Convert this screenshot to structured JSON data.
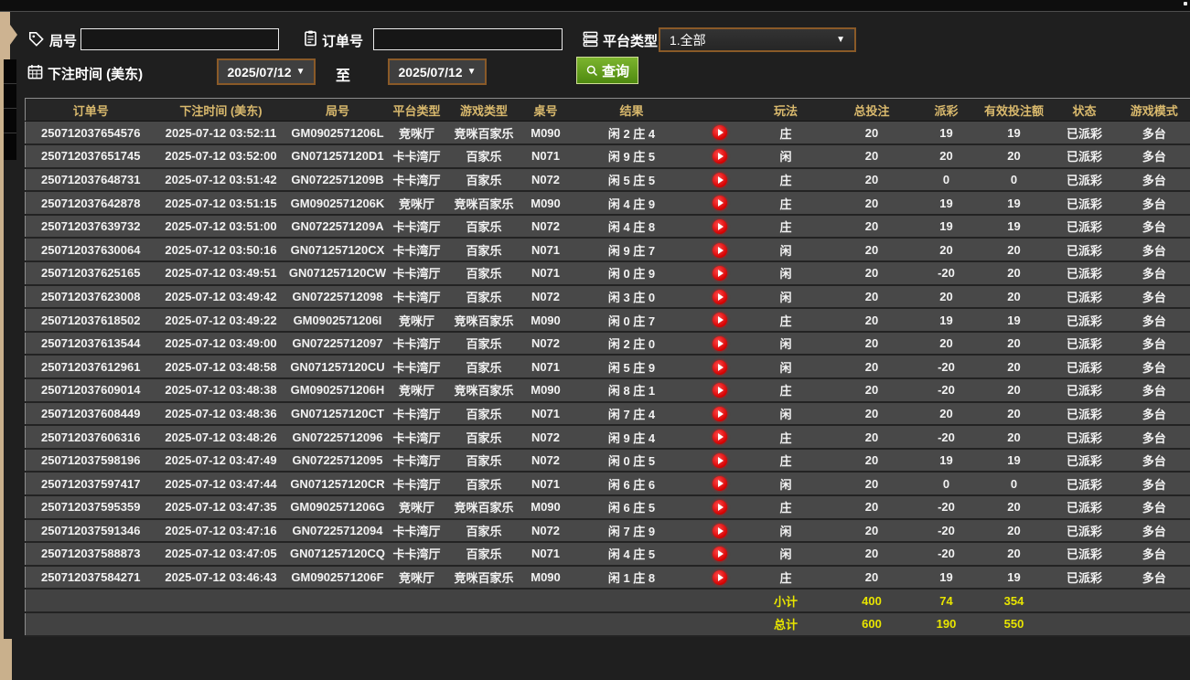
{
  "form": {
    "round_label": "局号",
    "round_value": "",
    "order_label": "订单号",
    "order_value": "",
    "platform_label": "平台类型",
    "platform_value": "1.全部",
    "time_label": "下注时间 (美东)",
    "date_from": "2025/07/12",
    "to_label": "至",
    "date_to": "2025/07/12",
    "query_label": "查询"
  },
  "colors": {
    "header_gold": "#d9b96d",
    "payout_red": "#c40000",
    "payout_green": "#53c500",
    "status_green": "#00c400",
    "totals_yellow": "#e8e500",
    "button_green": "#6aa51e",
    "picker_border_orange": "#8a5a28",
    "side_tan": "#c9b08c"
  },
  "table": {
    "columns": [
      "订单号",
      "下注时间 (美东)",
      "局号",
      "平台类型",
      "游戏类型",
      "桌号",
      "结果",
      "",
      "玩法",
      "总投注",
      "派彩",
      "有效投注额",
      "状态",
      "游戏模式"
    ],
    "rows": [
      {
        "order_no": "250712037654576",
        "bet_time": "2025-07-12 03:52:11",
        "round_no": "GM0902571206L",
        "platform": "竞咪厅",
        "game_type": "竞咪百家乐",
        "table_no": "M090",
        "result": "闲 2 庄 4",
        "play": "庄",
        "total_bet": "20",
        "payout": "19",
        "payout_color": "red",
        "valid_bet": "19",
        "status": "已派彩",
        "mode": "多台"
      },
      {
        "order_no": "250712037651745",
        "bet_time": "2025-07-12 03:52:00",
        "round_no": "GN071257120D1",
        "platform": "卡卡湾厅",
        "game_type": "百家乐",
        "table_no": "N071",
        "result": "闲 9 庄 5",
        "play": "闲",
        "total_bet": "20",
        "payout": "20",
        "payout_color": "red",
        "valid_bet": "20",
        "status": "已派彩",
        "mode": "多台"
      },
      {
        "order_no": "250712037648731",
        "bet_time": "2025-07-12 03:51:42",
        "round_no": "GN0722571209B",
        "platform": "卡卡湾厅",
        "game_type": "百家乐",
        "table_no": "N072",
        "result": "闲 5 庄 5",
        "play": "庄",
        "total_bet": "20",
        "payout": "0",
        "payout_color": "neutral",
        "valid_bet": "0",
        "status": "已派彩",
        "mode": "多台"
      },
      {
        "order_no": "250712037642878",
        "bet_time": "2025-07-12 03:51:15",
        "round_no": "GM0902571206K",
        "platform": "竞咪厅",
        "game_type": "竞咪百家乐",
        "table_no": "M090",
        "result": "闲 4 庄 9",
        "play": "庄",
        "total_bet": "20",
        "payout": "19",
        "payout_color": "red",
        "valid_bet": "19",
        "status": "已派彩",
        "mode": "多台"
      },
      {
        "order_no": "250712037639732",
        "bet_time": "2025-07-12 03:51:00",
        "round_no": "GN0722571209A",
        "platform": "卡卡湾厅",
        "game_type": "百家乐",
        "table_no": "N072",
        "result": "闲 4 庄 8",
        "play": "庄",
        "total_bet": "20",
        "payout": "19",
        "payout_color": "red",
        "valid_bet": "19",
        "status": "已派彩",
        "mode": "多台"
      },
      {
        "order_no": "250712037630064",
        "bet_time": "2025-07-12 03:50:16",
        "round_no": "GN071257120CX",
        "platform": "卡卡湾厅",
        "game_type": "百家乐",
        "table_no": "N071",
        "result": "闲 9 庄 7",
        "play": "闲",
        "total_bet": "20",
        "payout": "20",
        "payout_color": "red",
        "valid_bet": "20",
        "status": "已派彩",
        "mode": "多台"
      },
      {
        "order_no": "250712037625165",
        "bet_time": "2025-07-12 03:49:51",
        "round_no": "GN071257120CW",
        "platform": "卡卡湾厅",
        "game_type": "百家乐",
        "table_no": "N071",
        "result": "闲 0 庄 9",
        "play": "闲",
        "total_bet": "20",
        "payout": "-20",
        "payout_color": "green",
        "valid_bet": "20",
        "status": "已派彩",
        "mode": "多台"
      },
      {
        "order_no": "250712037623008",
        "bet_time": "2025-07-12 03:49:42",
        "round_no": "GN07225712098",
        "platform": "卡卡湾厅",
        "game_type": "百家乐",
        "table_no": "N072",
        "result": "闲 3 庄 0",
        "play": "闲",
        "total_bet": "20",
        "payout": "20",
        "payout_color": "red",
        "valid_bet": "20",
        "status": "已派彩",
        "mode": "多台"
      },
      {
        "order_no": "250712037618502",
        "bet_time": "2025-07-12 03:49:22",
        "round_no": "GM0902571206I",
        "platform": "竞咪厅",
        "game_type": "竞咪百家乐",
        "table_no": "M090",
        "result": "闲 0 庄 7",
        "play": "庄",
        "total_bet": "20",
        "payout": "19",
        "payout_color": "red",
        "valid_bet": "19",
        "status": "已派彩",
        "mode": "多台"
      },
      {
        "order_no": "250712037613544",
        "bet_time": "2025-07-12 03:49:00",
        "round_no": "GN07225712097",
        "platform": "卡卡湾厅",
        "game_type": "百家乐",
        "table_no": "N072",
        "result": "闲 2 庄 0",
        "play": "闲",
        "total_bet": "20",
        "payout": "20",
        "payout_color": "red",
        "valid_bet": "20",
        "status": "已派彩",
        "mode": "多台"
      },
      {
        "order_no": "250712037612961",
        "bet_time": "2025-07-12 03:48:58",
        "round_no": "GN071257120CU",
        "platform": "卡卡湾厅",
        "game_type": "百家乐",
        "table_no": "N071",
        "result": "闲 5 庄 9",
        "play": "闲",
        "total_bet": "20",
        "payout": "-20",
        "payout_color": "green",
        "valid_bet": "20",
        "status": "已派彩",
        "mode": "多台"
      },
      {
        "order_no": "250712037609014",
        "bet_time": "2025-07-12 03:48:38",
        "round_no": "GM0902571206H",
        "platform": "竞咪厅",
        "game_type": "竞咪百家乐",
        "table_no": "M090",
        "result": "闲 8 庄 1",
        "play": "庄",
        "total_bet": "20",
        "payout": "-20",
        "payout_color": "green",
        "valid_bet": "20",
        "status": "已派彩",
        "mode": "多台"
      },
      {
        "order_no": "250712037608449",
        "bet_time": "2025-07-12 03:48:36",
        "round_no": "GN071257120CT",
        "platform": "卡卡湾厅",
        "game_type": "百家乐",
        "table_no": "N071",
        "result": "闲 7 庄 4",
        "play": "闲",
        "total_bet": "20",
        "payout": "20",
        "payout_color": "red",
        "valid_bet": "20",
        "status": "已派彩",
        "mode": "多台"
      },
      {
        "order_no": "250712037606316",
        "bet_time": "2025-07-12 03:48:26",
        "round_no": "GN07225712096",
        "platform": "卡卡湾厅",
        "game_type": "百家乐",
        "table_no": "N072",
        "result": "闲 9 庄 4",
        "play": "庄",
        "total_bet": "20",
        "payout": "-20",
        "payout_color": "green",
        "valid_bet": "20",
        "status": "已派彩",
        "mode": "多台"
      },
      {
        "order_no": "250712037598196",
        "bet_time": "2025-07-12 03:47:49",
        "round_no": "GN07225712095",
        "platform": "卡卡湾厅",
        "game_type": "百家乐",
        "table_no": "N072",
        "result": "闲 0 庄 5",
        "play": "庄",
        "total_bet": "20",
        "payout": "19",
        "payout_color": "red",
        "valid_bet": "19",
        "status": "已派彩",
        "mode": "多台"
      },
      {
        "order_no": "250712037597417",
        "bet_time": "2025-07-12 03:47:44",
        "round_no": "GN071257120CR",
        "platform": "卡卡湾厅",
        "game_type": "百家乐",
        "table_no": "N071",
        "result": "闲 6 庄 6",
        "play": "闲",
        "total_bet": "20",
        "payout": "0",
        "payout_color": "neutral",
        "valid_bet": "0",
        "status": "已派彩",
        "mode": "多台"
      },
      {
        "order_no": "250712037595359",
        "bet_time": "2025-07-12 03:47:35",
        "round_no": "GM0902571206G",
        "platform": "竞咪厅",
        "game_type": "竞咪百家乐",
        "table_no": "M090",
        "result": "闲 6 庄 5",
        "play": "庄",
        "total_bet": "20",
        "payout": "-20",
        "payout_color": "green",
        "valid_bet": "20",
        "status": "已派彩",
        "mode": "多台"
      },
      {
        "order_no": "250712037591346",
        "bet_time": "2025-07-12 03:47:16",
        "round_no": "GN07225712094",
        "platform": "卡卡湾厅",
        "game_type": "百家乐",
        "table_no": "N072",
        "result": "闲 7 庄 9",
        "play": "闲",
        "total_bet": "20",
        "payout": "-20",
        "payout_color": "green",
        "valid_bet": "20",
        "status": "已派彩",
        "mode": "多台"
      },
      {
        "order_no": "250712037588873",
        "bet_time": "2025-07-12 03:47:05",
        "round_no": "GN071257120CQ",
        "platform": "卡卡湾厅",
        "game_type": "百家乐",
        "table_no": "N071",
        "result": "闲 4 庄 5",
        "play": "闲",
        "total_bet": "20",
        "payout": "-20",
        "payout_color": "green",
        "valid_bet": "20",
        "status": "已派彩",
        "mode": "多台"
      },
      {
        "order_no": "250712037584271",
        "bet_time": "2025-07-12 03:46:43",
        "round_no": "GM0902571206F",
        "platform": "竞咪厅",
        "game_type": "竞咪百家乐",
        "table_no": "M090",
        "result": "闲 1 庄 8",
        "play": "庄",
        "total_bet": "20",
        "payout": "19",
        "payout_color": "red",
        "valid_bet": "19",
        "status": "已派彩",
        "mode": "多台"
      }
    ],
    "subtotal": {
      "label": "小计",
      "total_bet": "400",
      "payout": "74",
      "valid_bet": "354"
    },
    "grand_total": {
      "label": "总计",
      "total_bet": "600",
      "payout": "190",
      "valid_bet": "550"
    }
  }
}
